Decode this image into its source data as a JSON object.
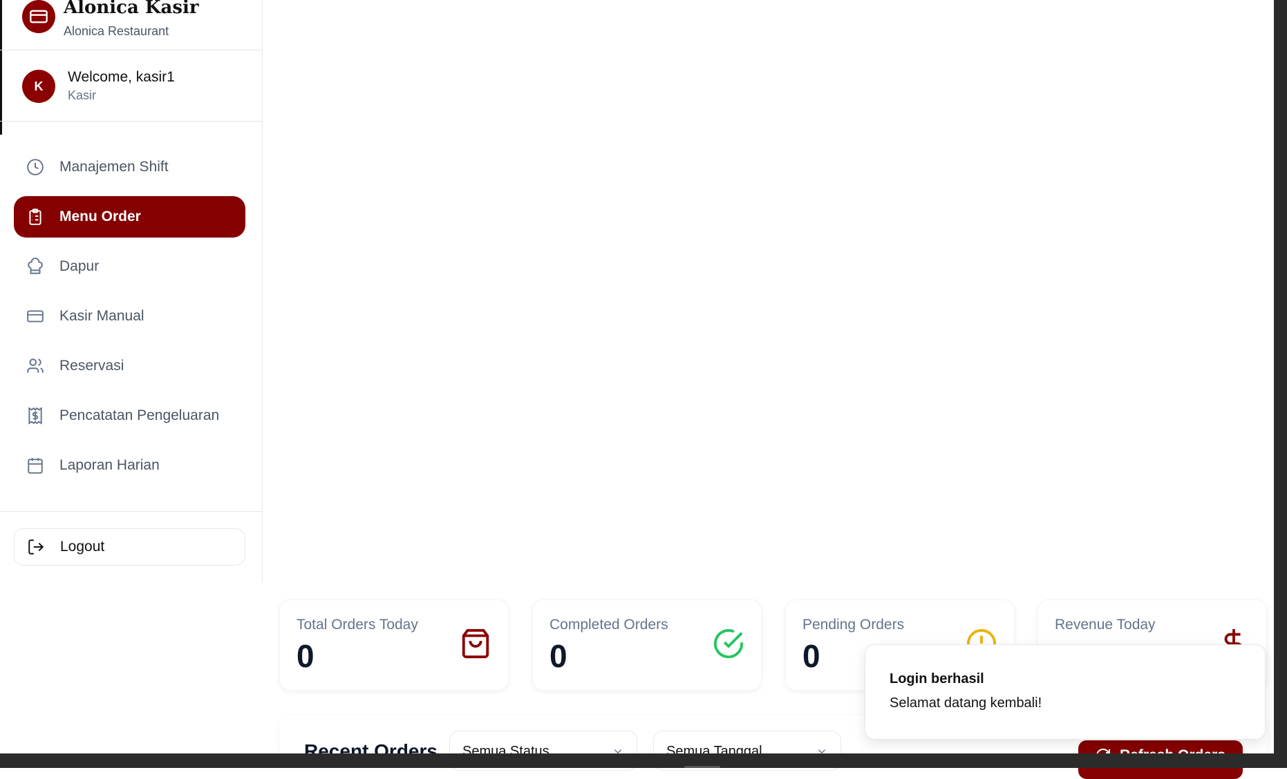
{
  "brand": {
    "title": "Alonica Kasir",
    "subtitle": "Alonica Restaurant"
  },
  "user": {
    "avatar_letter": "K",
    "welcome": "Welcome, kasir1",
    "role": "Kasir"
  },
  "nav": [
    {
      "label": "Manajemen Shift",
      "icon": "clock-icon"
    },
    {
      "label": "Menu Order",
      "icon": "clipboard-list-icon",
      "active": true
    },
    {
      "label": "Dapur",
      "icon": "chef-hat-icon"
    },
    {
      "label": "Kasir Manual",
      "icon": "credit-card-icon"
    },
    {
      "label": "Reservasi",
      "icon": "users-icon"
    },
    {
      "label": "Pencatatan Pengeluaran",
      "icon": "receipt-dollar-icon"
    },
    {
      "label": "Laporan Harian",
      "icon": "calendar-icon"
    }
  ],
  "logout": {
    "label": "Logout",
    "icon": "logout-icon"
  },
  "stats": [
    {
      "label": "Total Orders Today",
      "value": "0",
      "icon": "shopping-bag-icon",
      "color": "#8b0000"
    },
    {
      "label": "Completed Orders",
      "value": "0",
      "icon": "check-circle-icon",
      "color": "#22c55e"
    },
    {
      "label": "Pending Orders",
      "value": "0",
      "icon": "clock-icon",
      "color": "#eab308"
    },
    {
      "label": "Revenue Today",
      "value": "",
      "icon": "dollar-icon",
      "color": "#8b0000"
    }
  ],
  "orders": {
    "title": "Recent Orders",
    "status_filter": "Semua Status",
    "date_filter": "Semua Tanggal",
    "refresh_label": "Refresh Orders"
  },
  "toast": {
    "title": "Login berhasil",
    "description": "Selamat datang kembali!"
  },
  "colors": {
    "brand": "#850000",
    "success": "#22c55e",
    "warning": "#eab308"
  }
}
